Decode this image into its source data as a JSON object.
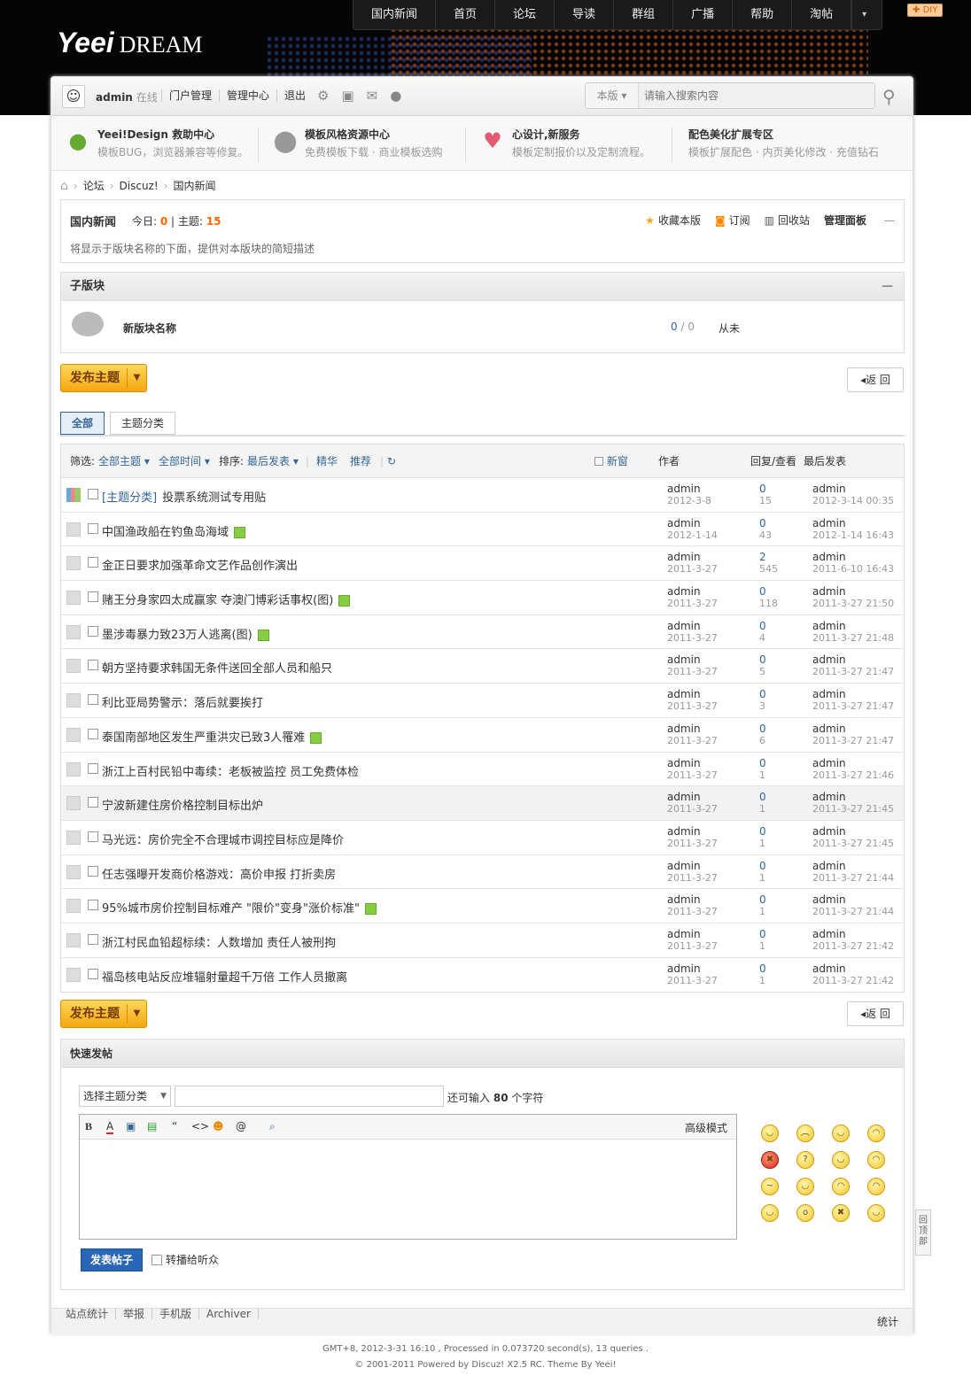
{
  "logo": {
    "brand": "Yeei",
    "suffix": "DREAM"
  },
  "nav": [
    "国内新闻",
    "首页",
    "论坛",
    "导读",
    "群组",
    "广播",
    "帮助",
    "淘帖"
  ],
  "diy": "DIY",
  "user": {
    "name": "admin",
    "status": "在线",
    "links": [
      "门户管理",
      "管理中心",
      "退出"
    ]
  },
  "search": {
    "scope": "本版",
    "placeholder": "请输入搜索内容"
  },
  "promo": [
    {
      "title": "Yeei!Design 救助中心",
      "desc": "模板BUG，浏览器兼容等修复。"
    },
    {
      "title": "模板风格资源中心",
      "desc": "免费模板下载 · 商业模板选购"
    },
    {
      "title": "心设计,新服务",
      "desc": "模板定制报价以及定制流程。"
    },
    {
      "title": "配色美化扩展专区",
      "desc": "模板扩展配色 · 内页美化修改 · 充值钻石"
    }
  ],
  "breadcrumb": [
    "论坛",
    "Discuz!",
    "国内新闻"
  ],
  "forum": {
    "name": "国内新闻",
    "today_label": "今日:",
    "today": "0",
    "threads_label": "主题:",
    "threads": "15",
    "actions": [
      "收藏本版",
      "订阅",
      "回收站",
      "管理面板"
    ],
    "desc": "将显示于版块名称的下面，提供对本版块的简短描述"
  },
  "subforum": {
    "header": "子版块",
    "name": "新版块名称",
    "threads": "0",
    "posts": "0",
    "last": "从未"
  },
  "post_button": "发布主题",
  "back_button": "返 回",
  "tabs": [
    "全部",
    "主题分类"
  ],
  "filter": {
    "label": "筛选:",
    "all_threads": "全部主题",
    "all_time": "全部时间",
    "sort_label": "排序:",
    "sort": "最后发表",
    "digest": "精华",
    "recommend": "推荐",
    "newwin": "新窗",
    "col_author": "作者",
    "col_replies": "回复/查看",
    "col_last": "最后发表"
  },
  "threads": [
    {
      "cat": "[主题分类]",
      "title": "投票系统测试专用贴",
      "author": "admin",
      "date": "2012-3-8",
      "replies": "0",
      "views": "15",
      "last_user": "admin",
      "last_time": "2012-3-14 00:35",
      "img": false,
      "poll": true
    },
    {
      "cat": "",
      "title": "中国渔政船在钓鱼岛海域",
      "author": "admin",
      "date": "2012-1-14",
      "replies": "0",
      "views": "43",
      "last_user": "admin",
      "last_time": "2012-1-14 16:43",
      "img": true
    },
    {
      "cat": "",
      "title": "金正日要求加强革命文艺作品创作演出",
      "author": "admin",
      "date": "2011-3-27",
      "replies": "2",
      "views": "545",
      "last_user": "admin",
      "last_time": "2011-6-10 16:43",
      "img": false
    },
    {
      "cat": "",
      "title": "赌王分身家四太成赢家 夺澳门博彩话事权(图)",
      "author": "admin",
      "date": "2011-3-27",
      "replies": "0",
      "views": "118",
      "last_user": "admin",
      "last_time": "2011-3-27 21:50",
      "img": true
    },
    {
      "cat": "",
      "title": "墨涉毒暴力致23万人逃离(图)",
      "author": "admin",
      "date": "2011-3-27",
      "replies": "0",
      "views": "4",
      "last_user": "admin",
      "last_time": "2011-3-27 21:48",
      "img": true
    },
    {
      "cat": "",
      "title": "朝方坚持要求韩国无条件送回全部人员和船只",
      "author": "admin",
      "date": "2011-3-27",
      "replies": "0",
      "views": "5",
      "last_user": "admin",
      "last_time": "2011-3-27 21:47",
      "img": false
    },
    {
      "cat": "",
      "title": "利比亚局势警示：落后就要挨打",
      "author": "admin",
      "date": "2011-3-27",
      "replies": "0",
      "views": "3",
      "last_user": "admin",
      "last_time": "2011-3-27 21:47",
      "img": false
    },
    {
      "cat": "",
      "title": "泰国南部地区发生严重洪灾已致3人罹难",
      "author": "admin",
      "date": "2011-3-27",
      "replies": "0",
      "views": "6",
      "last_user": "admin",
      "last_time": "2011-3-27 21:47",
      "img": true
    },
    {
      "cat": "",
      "title": "浙江上百村民铅中毒续：老板被监控 员工免费体检",
      "author": "admin",
      "date": "2011-3-27",
      "replies": "0",
      "views": "1",
      "last_user": "admin",
      "last_time": "2011-3-27 21:46",
      "img": false
    },
    {
      "cat": "",
      "title": "宁波新建住房价格控制目标出炉",
      "author": "admin",
      "date": "2011-3-27",
      "replies": "0",
      "views": "1",
      "last_user": "admin",
      "last_time": "2011-3-27 21:45",
      "img": false,
      "hl": true
    },
    {
      "cat": "",
      "title": "马光远：房价完全不合理城市调控目标应是降价",
      "author": "admin",
      "date": "2011-3-27",
      "replies": "0",
      "views": "1",
      "last_user": "admin",
      "last_time": "2011-3-27 21:45",
      "img": false
    },
    {
      "cat": "",
      "title": "任志强曝开发商价格游戏：高价申报 打折卖房",
      "author": "admin",
      "date": "2011-3-27",
      "replies": "0",
      "views": "1",
      "last_user": "admin",
      "last_time": "2011-3-27 21:44",
      "img": false
    },
    {
      "cat": "",
      "title": "95%城市房价控制目标难产 \"限价\"变身\"涨价标准\"",
      "author": "admin",
      "date": "2011-3-27",
      "replies": "0",
      "views": "1",
      "last_user": "admin",
      "last_time": "2011-3-27 21:44",
      "img": true
    },
    {
      "cat": "",
      "title": "浙江村民血铅超标续：人数增加 责任人被刑拘",
      "author": "admin",
      "date": "2011-3-27",
      "replies": "0",
      "views": "1",
      "last_user": "admin",
      "last_time": "2011-3-27 21:42",
      "img": false
    },
    {
      "cat": "",
      "title": "福岛核电站反应堆辐射量超千万倍 工作人员撤离",
      "author": "admin",
      "date": "2011-3-27",
      "replies": "0",
      "views": "1",
      "last_user": "admin",
      "last_time": "2011-3-27 21:42",
      "img": false
    }
  ],
  "quickpost": {
    "header": "快速发帖",
    "select": "选择主题分类",
    "remain_pre": "还可输入",
    "remain": "80",
    "remain_post": "个字符",
    "advanced": "高级模式",
    "submit": "发表帖子",
    "broadcast": "转播给听众"
  },
  "footer": {
    "links": [
      "站点统计",
      "举报",
      "手机版",
      "Archiver"
    ],
    "right": "统计"
  },
  "copyright": {
    "line1": "GMT+8, 2012-3-31 16:10 , Processed in 0.073720 second(s), 13 queries .",
    "line2": "© 2001-2011 Powered by Discuz! X2.5 RC. Theme By Yeei!"
  },
  "totop": "回顶部"
}
